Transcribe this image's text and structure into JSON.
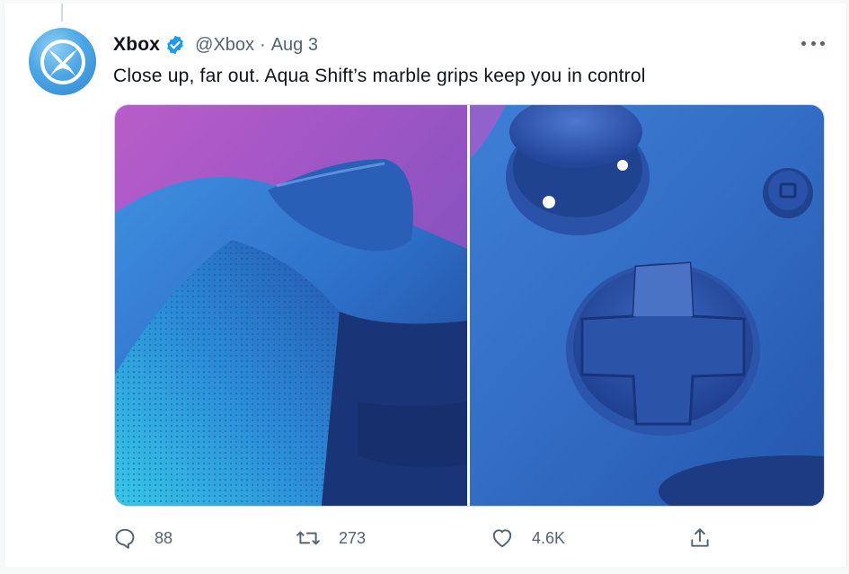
{
  "author": {
    "name": "Xbox",
    "handle": "@Xbox",
    "separator": "·",
    "date": "Aug 3",
    "verified": true
  },
  "tweet": {
    "text": "Close up, far out. Aqua Shift’s marble grips keep you in control"
  },
  "actions": {
    "reply_count": "88",
    "retweet_count": "273",
    "like_count": "4.6K"
  },
  "colors": {
    "accent": "#1d9bf0",
    "text": "#0f1419",
    "secondary": "#536471",
    "controller_blue": "#3a6fc4"
  },
  "icons": [
    "xbox-logo-icon",
    "verified-badge-icon",
    "more-icon",
    "reply-icon",
    "retweet-icon",
    "like-icon",
    "share-icon"
  ]
}
